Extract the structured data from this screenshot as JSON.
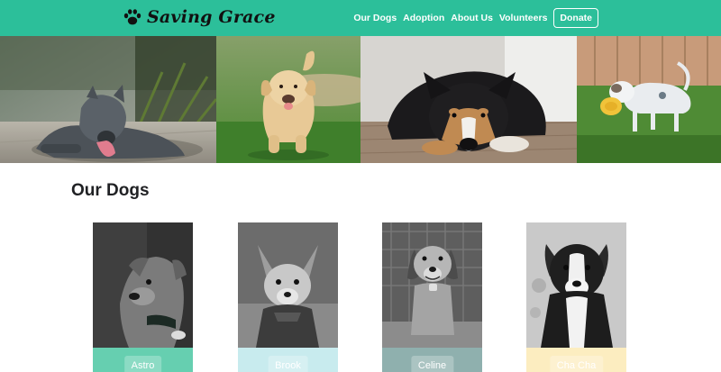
{
  "header": {
    "logo_text": "Saving Grace",
    "logo_icon": "paw-print-icon",
    "nav": [
      "Our Dogs",
      "Adoption",
      "About Us",
      "Volunteers"
    ],
    "donate_label": "Donate"
  },
  "hero": {
    "photos": [
      "grey-pit-bull-lying-photo",
      "golden-puppy-running-photo",
      "black-tan-dog-lying-photo",
      "white-dog-with-frisbee-photo"
    ]
  },
  "section": {
    "title": "Our Dogs"
  },
  "dogs": [
    {
      "name": "Astro",
      "bar_color": "#66cfb0"
    },
    {
      "name": "Brook",
      "bar_color": "#c8ebee"
    },
    {
      "name": "Celine",
      "bar_color": "#8fb0ae"
    },
    {
      "name": "Cha Cha",
      "bar_color": "#fcedc0"
    }
  ]
}
